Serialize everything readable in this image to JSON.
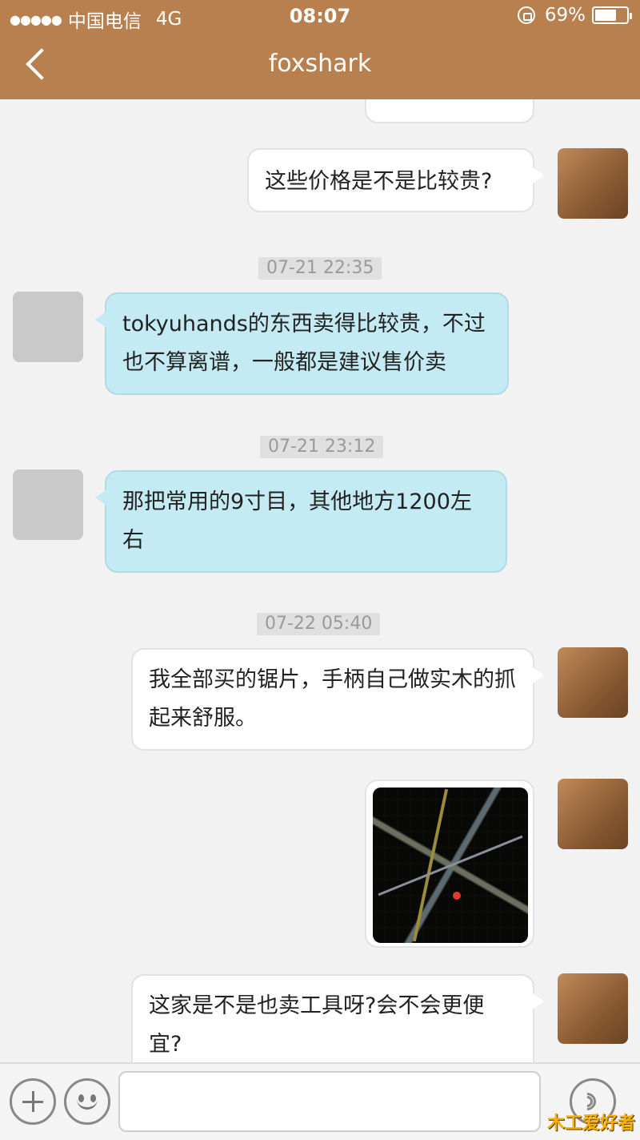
{
  "status_bar": {
    "signal": "●●●●●",
    "carrier": "中国电信",
    "network": "4G",
    "time": "08:07",
    "battery": "69%",
    "battery_level": 0.69
  },
  "nav": {
    "title": "foxshark"
  },
  "messages": {
    "m1": "这些价格是不是比较贵?",
    "t1": "07-21 22:35",
    "m2": "tokyuhands的东西卖得比较贵，不过也不算离谱，一般都是建议售价卖",
    "t2": "07-21 23:12",
    "m3": "那把常用的9寸目，其他地方1200左右",
    "t3": "07-22 05:40",
    "m4": "我全部买的锯片，手柄自己做实木的抓起来舒服。",
    "m6": "这家是不是也卖工具呀?会不会更便宜?"
  },
  "input": {
    "value": ""
  },
  "watermark": "木工爱好者",
  "colors": {
    "header": "#b8804f",
    "bubble_other": "#c4eaf3",
    "bubble_me": "#ffffff"
  },
  "icons": [
    "back-icon",
    "lock-icon",
    "battery-icon",
    "add-icon",
    "emoji-icon",
    "voice-icon"
  ]
}
